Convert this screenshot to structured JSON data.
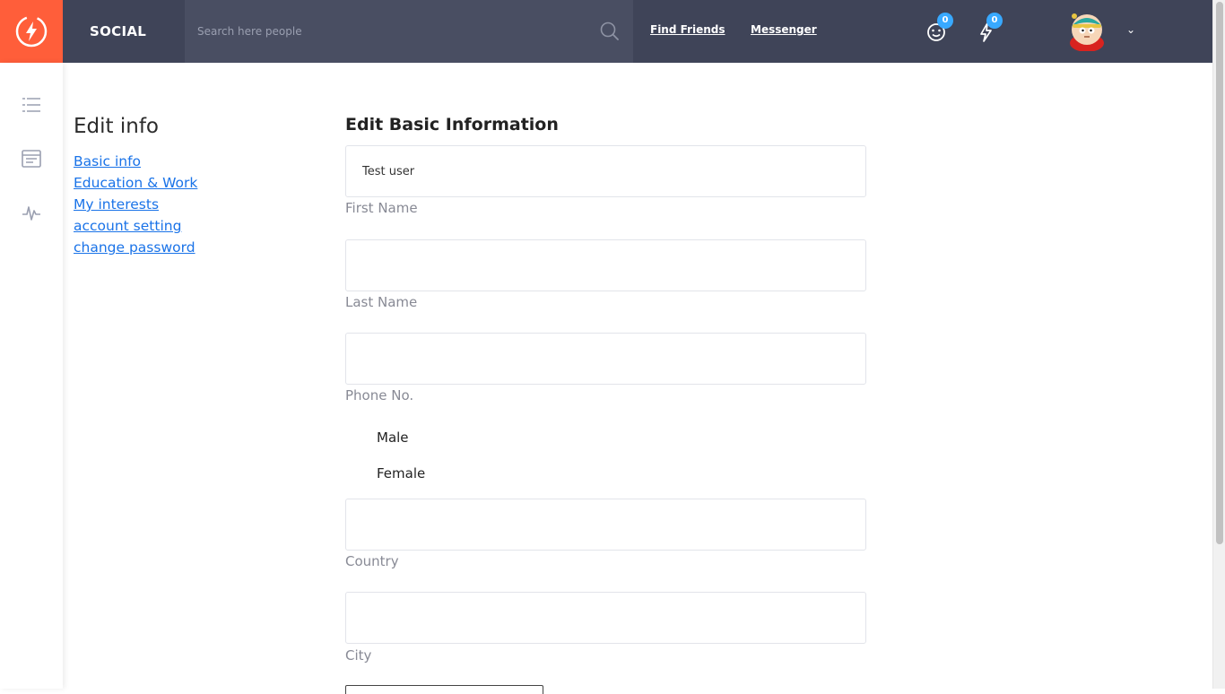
{
  "header": {
    "brand": "SOCIAL",
    "search_placeholder": "Search here people",
    "links": [
      "Find Friends",
      "Messenger"
    ],
    "notifications": [
      {
        "icon": "smiley-icon",
        "count": "0"
      },
      {
        "icon": "lightning-icon",
        "count": "0"
      }
    ]
  },
  "edit_menu": {
    "title": "Edit info",
    "items": [
      "Basic info",
      "Education & Work",
      "My interests",
      "account setting",
      "change password"
    ]
  },
  "form": {
    "title": "Edit Basic Information",
    "first_name_value": "Test user",
    "first_name_label": "First Name",
    "last_name_label": "Last Name",
    "phone_label": "Phone No.",
    "gender_options": [
      "Male",
      "Female"
    ],
    "country_label": "Country",
    "city_label": "City"
  },
  "colors": {
    "accent": "#ff5e3a",
    "topbar": "#3f4458",
    "badge": "#38a9ff",
    "link": "#1a73e8"
  }
}
